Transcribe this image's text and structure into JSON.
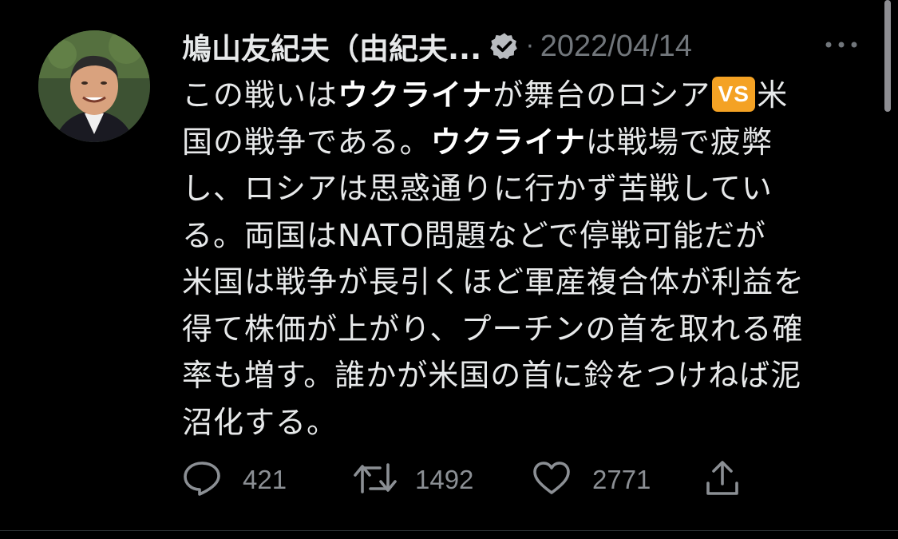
{
  "author": {
    "display_name": "鳩山友紀夫（由紀夫...",
    "verified": true
  },
  "timestamp": "2022/04/14",
  "separator": "·",
  "tweet": {
    "lines": [
      [
        "この戦いは",
        "ウクライナ",
        "が舞台のロシア",
        "VS",
        "米"
      ],
      [
        "国の戦争である。",
        "ウクライナ",
        "は戦場で疲弊"
      ],
      [
        "し、ロシアは思惑通りに行かず苦戦してい"
      ],
      [
        "る。両国はNATO問題などで停戦可能だが"
      ],
      [
        "米国は戦争が長引くほど軍産複合体が利益を"
      ],
      [
        "得て株価が上がり、プーチンの首を取れる確"
      ],
      [
        "率も増す。誰かが米国の首に鈴をつけねば泥"
      ],
      [
        "沼化する。"
      ]
    ]
  },
  "actions": {
    "replies": "421",
    "retweets": "1492",
    "likes": "2771"
  },
  "icons": {
    "verified": "verified-badge-icon",
    "more": "more-options-icon",
    "reply": "reply-icon",
    "retweet": "retweet-icon",
    "like": "heart-icon",
    "share": "share-icon"
  },
  "colors": {
    "background": "#000000",
    "text": "#e7e9ea",
    "muted": "#71767b",
    "vs_badge": "#f4a224"
  }
}
